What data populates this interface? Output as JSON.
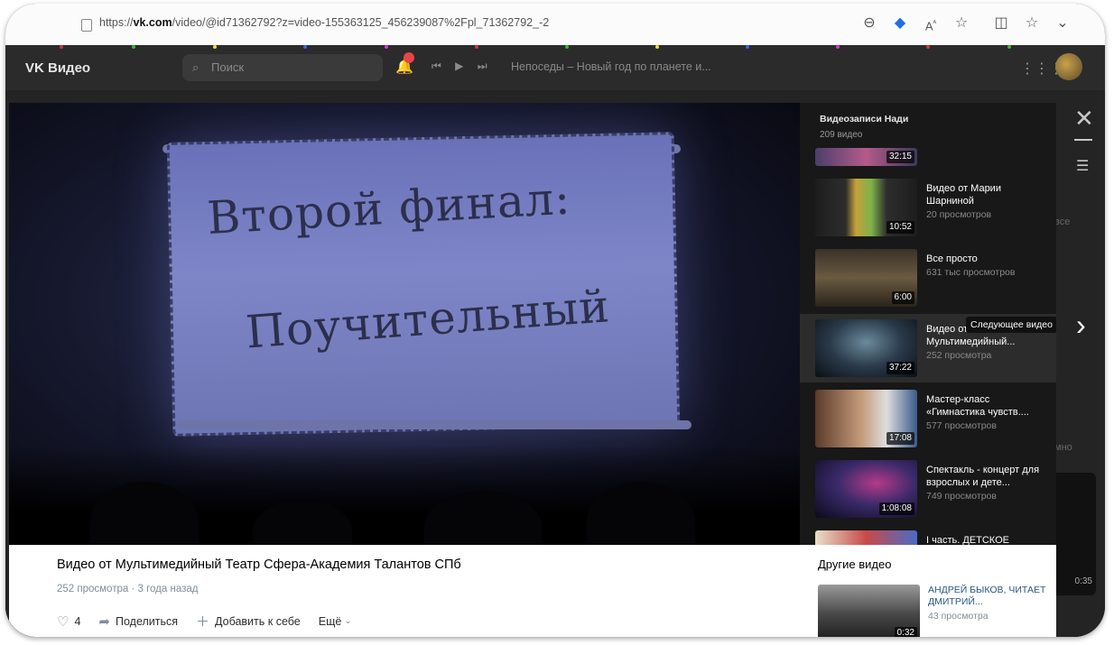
{
  "browser": {
    "url_prefix": "https://",
    "url_domain": "vk.com",
    "url_rest": "/video/@id71362792?z=video-155363125_456239087%2Fpl_71362792_-2",
    "icons": [
      "zoom-icon",
      "tag-icon",
      "read-aloud-icon",
      "favorite-icon",
      "split-view-icon",
      "favorites-list-icon"
    ]
  },
  "vk": {
    "logo": "VK Видео",
    "search_placeholder": "Поиск",
    "now_playing": "Непоседы – Новый год по планете и...",
    "side_link_1": "все",
    "side_link_2": "мно",
    "card_duration": "0:35"
  },
  "video": {
    "banner_line1": "Второй финал:",
    "banner_line2": "Поучительный",
    "title": "Видео от Мультимедийный Театр Сфера-Академия Талантов СПб",
    "views": "252 просмотра",
    "date": "3 года назад",
    "likes": "4",
    "share_label": "Поделиться",
    "add_label": "Добавить к себе",
    "more_label": "Ещё"
  },
  "playlist": {
    "title": "Видеозаписи Нади",
    "count": "209 видео",
    "top_duration": "32:15",
    "tooltip": "Следующее видео",
    "items": [
      {
        "name": "Видео от Марии Шарниной",
        "views": "20 просмотров",
        "duration": "10:52"
      },
      {
        "name": "Все просто",
        "views": "631 тыс просмотров",
        "duration": "6:00"
      },
      {
        "name": "Видео от Мультимедийный...",
        "views": "252 просмотра",
        "duration": "37:22"
      },
      {
        "name": "Мастер-класс «Гимнастика чувств....",
        "views": "577 просмотров",
        "duration": "17:08"
      },
      {
        "name": "Спектакль - концерт для взрослых и дете...",
        "views": "749 просмотров",
        "duration": "1:08:08"
      },
      {
        "name": "I часть. ДЕТСКОЕ",
        "views": "",
        "duration": ""
      }
    ]
  },
  "others": {
    "heading": "Другие видео",
    "item": {
      "name": "АНДРЕЙ БЫКОВ, ЧИТАЕТ ДМИТРИЙ...",
      "views": "43 просмотра",
      "duration": "0:32"
    }
  },
  "colors": {
    "accent_link": "#2a5885",
    "meta_gray": "#818c99",
    "playlist_bg": "#181818"
  }
}
